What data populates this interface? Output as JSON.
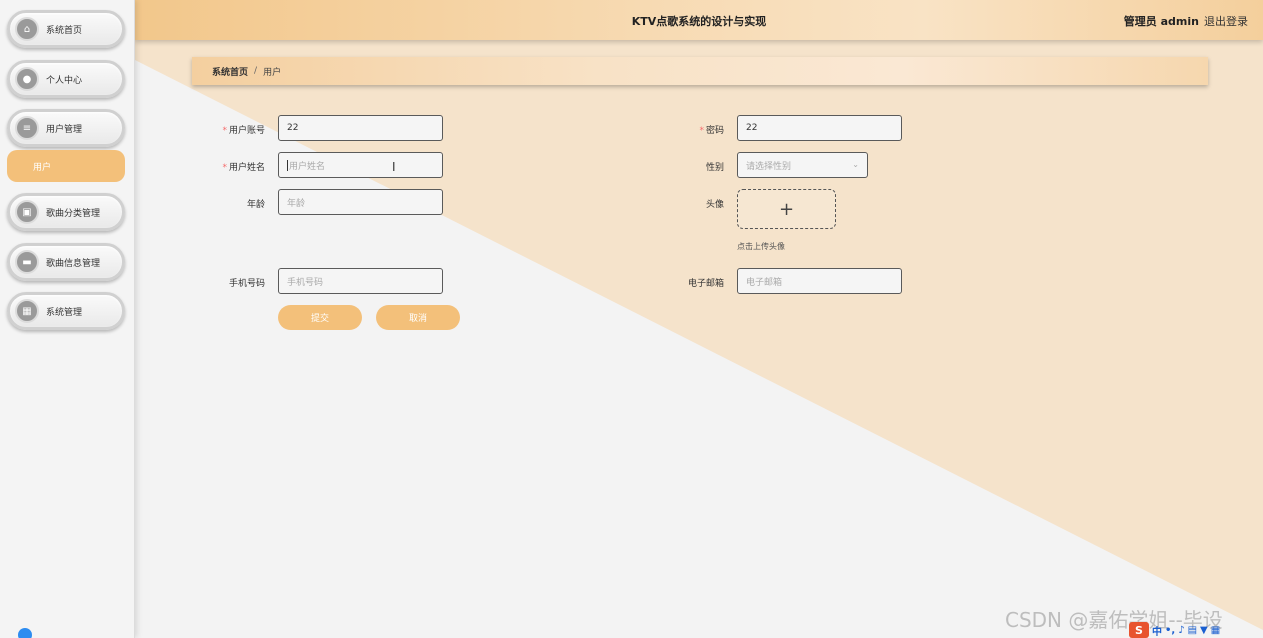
{
  "header": {
    "title": "KTV点歌系统的设计与实现",
    "admin": "管理员 admin",
    "logout": "退出登录"
  },
  "sidebar": {
    "items": [
      {
        "label": "系统首页",
        "icon": "home-icon"
      },
      {
        "label": "个人中心",
        "icon": "user-icon"
      },
      {
        "label": "用户管理",
        "icon": "list-icon"
      },
      {
        "label": "歌曲分类管理",
        "icon": "category-icon"
      },
      {
        "label": "歌曲信息管理",
        "icon": "message-icon"
      },
      {
        "label": "系统管理",
        "icon": "grid-icon"
      }
    ],
    "sub_item": "用户"
  },
  "breadcrumb": {
    "home": "系统首页",
    "separator": "/",
    "current": "用户"
  },
  "form": {
    "account_label": "用户账号",
    "account_value": "22",
    "password_label": "密码",
    "password_value": "22",
    "name_label": "用户姓名",
    "name_placeholder": "用户姓名",
    "gender_label": "性别",
    "gender_placeholder": "请选择性别",
    "age_label": "年龄",
    "age_placeholder": "年龄",
    "avatar_label": "头像",
    "avatar_tip": "点击上传头像",
    "phone_label": "手机号码",
    "phone_placeholder": "手机号码",
    "email_label": "电子邮箱",
    "email_placeholder": "电子邮箱",
    "required_mark": "*",
    "submit": "提交",
    "cancel": "取消"
  },
  "watermark": "CSDN @嘉佑学姐--毕设",
  "ime": {
    "logo": "S",
    "mode": "中"
  },
  "colors": {
    "accent": "#f3c07a",
    "header_start": "#f2c78b",
    "triangle": "#f5e3cb",
    "required": "#f56c6c"
  }
}
